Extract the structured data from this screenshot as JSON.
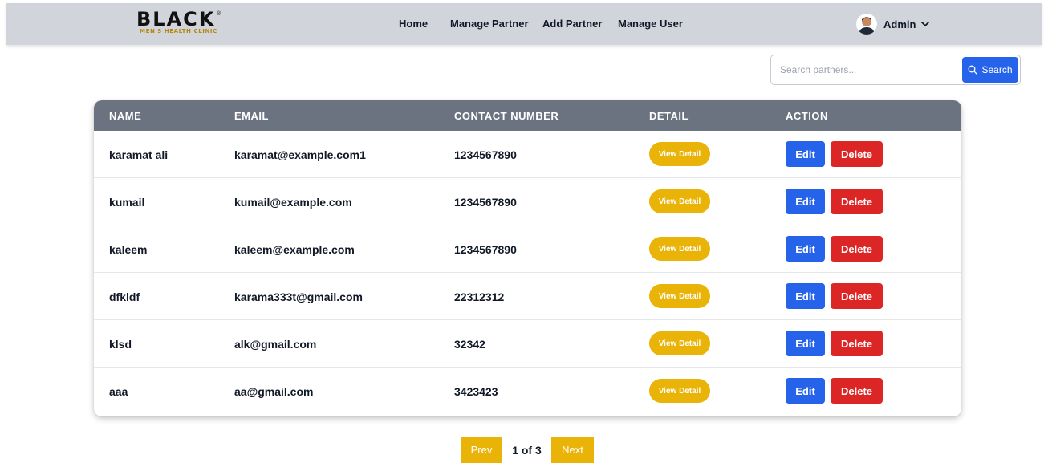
{
  "brand": {
    "logo_main": "BLACK",
    "logo_sub": "MEN'S HEALTH CLINIC",
    "logo_mark": "®"
  },
  "nav": {
    "items": [
      {
        "label": "Home"
      },
      {
        "label": "Manage Partner"
      },
      {
        "label": "Add Partner"
      },
      {
        "label": "Manage User"
      }
    ],
    "user": {
      "name": "Admin",
      "icon": "chevron-down-icon"
    }
  },
  "search": {
    "placeholder": "Search partners...",
    "value": "",
    "button_label": "Search"
  },
  "table": {
    "columns": [
      "NAME",
      "EMAIL",
      "CONTACT NUMBER",
      "DETAIL",
      "ACTION"
    ],
    "rows": [
      {
        "name": "karamat ali",
        "email": "karamat@example.com1",
        "contact": "1234567890"
      },
      {
        "name": "kumail",
        "email": "kumail@example.com",
        "contact": "1234567890"
      },
      {
        "name": "kaleem",
        "email": "kaleem@example.com",
        "contact": "1234567890"
      },
      {
        "name": "dfkldf",
        "email": "karama333t@gmail.com",
        "contact": "22312312"
      },
      {
        "name": "klsd",
        "email": "alk@gmail.com",
        "contact": "32342"
      },
      {
        "name": "aaa",
        "email": "aa@gmail.com",
        "contact": "3423423"
      }
    ],
    "view_label": "View Detail",
    "edit_label": "Edit",
    "delete_label": "Delete"
  },
  "pagination": {
    "prev_label": "Prev",
    "info": "1 of 3",
    "next_label": "Next"
  },
  "colors": {
    "navbar_bg": "#d1d5db",
    "table_header_bg": "#6b7280",
    "primary_blue": "#2563eb",
    "danger_red": "#dc2626",
    "accent_yellow": "#eab308"
  }
}
